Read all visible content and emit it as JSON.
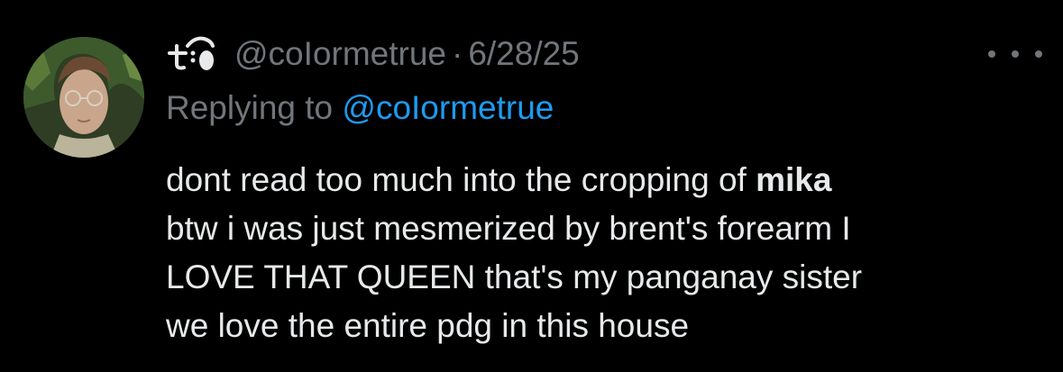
{
  "tweet": {
    "handle": "@coIormetrue",
    "separator": "·",
    "date": "6/28/25",
    "replying_prefix": "Replying to ",
    "replying_handle": "@coIormetrue",
    "body": {
      "line1_a": "dont read too much into the cropping of ",
      "line1_bold": "mika",
      "line2": "btw i was just mesmerized by brent's forearm I",
      "line3": "LOVE THAT QUEEN that's my panganay sister",
      "line4": "we love the entire pdg in this house"
    }
  },
  "colors": {
    "background": "#000000",
    "text": "#e7e9ea",
    "muted": "#71767b",
    "link": "#1d9bf0"
  },
  "icons": {
    "avatar": "profile-photo",
    "display_name": "stylized-glyph-name",
    "more": "more-options-icon"
  }
}
